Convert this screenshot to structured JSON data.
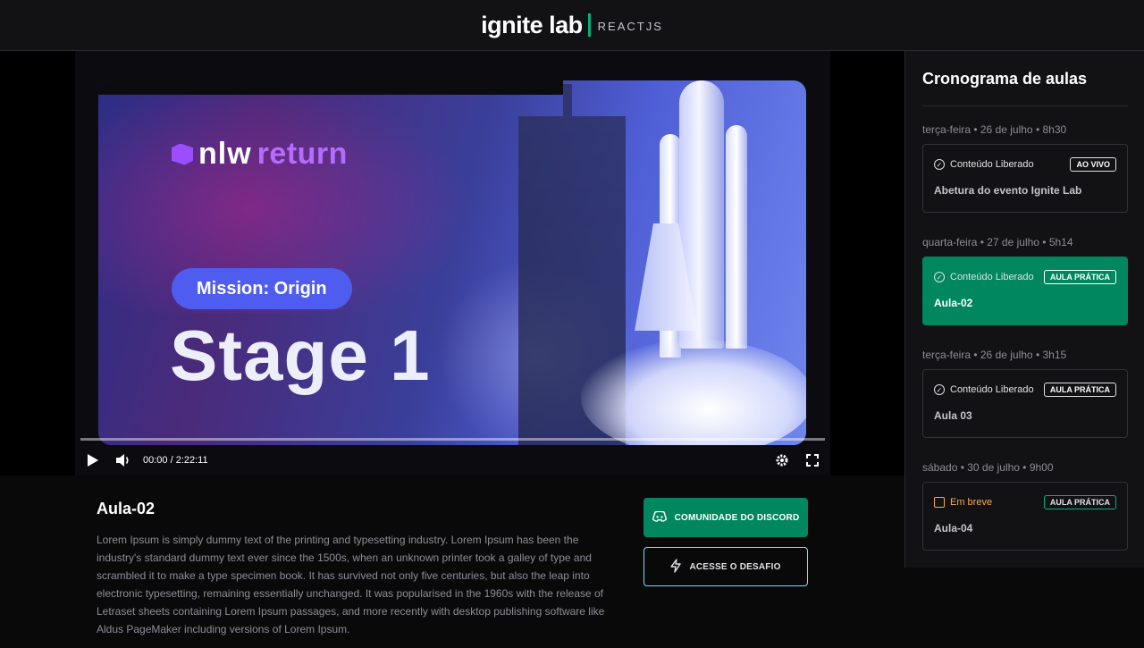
{
  "header": {
    "logo_main": "ignite lab",
    "logo_sub": "REACTJS"
  },
  "video": {
    "poster": {
      "brand_prefix": "nlw",
      "brand_suffix": "return",
      "mission_label": "Mission: Origin",
      "stage_title": "Stage 1"
    },
    "time": "00:00 / 2:22:11",
    "progress": 0.0
  },
  "sidebar": {
    "title": "Cronograma de aulas",
    "lessons": [
      {
        "date": "terça-feira • 26 de julho • 8h30",
        "status": "Conteúdo Liberado",
        "badge": "AO VIVO",
        "title": "Abetura do evento Ignite Lab",
        "active": false,
        "available": true
      },
      {
        "date": "quarta-feira • 27 de julho • 5h14",
        "status": "Conteúdo Liberado",
        "badge": "AULA PRÁTICA",
        "title": "Aula-02",
        "active": true,
        "available": true
      },
      {
        "date": "terça-feira • 26 de julho • 3h15",
        "status": "Conteúdo Liberado",
        "badge": "AULA PRÁTICA",
        "title": "Aula 03",
        "active": false,
        "available": true
      },
      {
        "date": "sábado • 30 de julho • 9h00",
        "status": "Em breve",
        "badge": "AULA PRÁTICA",
        "title": "Aula-04",
        "active": false,
        "available": false
      }
    ]
  },
  "lesson": {
    "title": "Aula-02",
    "description": "Lorem Ipsum is simply dummy text of the printing and typesetting industry. Lorem Ipsum has been the industry's standard dummy text ever since the 1500s, when an unknown printer took a galley of type and scrambled it to make a type specimen book. It has survived not only five centuries, but also the leap into electronic typesetting, remaining essentially unchanged. It was popularised in the 1960s with the release of Letraset sheets containing Lorem Ipsum passages, and more recently with desktop publishing software like Aldus PageMaker including versions of Lorem Ipsum."
  },
  "actions": {
    "discord_label": "COMUNIDADE DO DISCORD",
    "challenge_label": "ACESSE O DESAFIO"
  },
  "colors": {
    "accent_green": "#00875f",
    "accent_blue": "#81d8f7",
    "warning": "#fba94c"
  }
}
